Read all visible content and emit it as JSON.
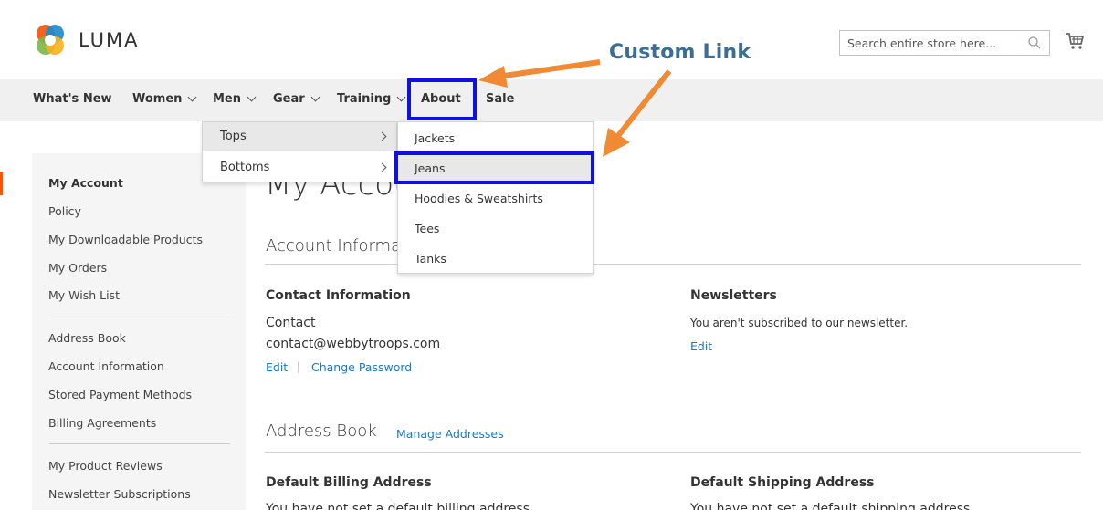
{
  "brand": {
    "name": "LUMA"
  },
  "search": {
    "placeholder": "Search entire store here..."
  },
  "annotation": {
    "custom_link": "Custom Link"
  },
  "nav": {
    "items": [
      {
        "label": "What's New",
        "has_chevron": false
      },
      {
        "label": "Women",
        "has_chevron": true
      },
      {
        "label": "Men",
        "has_chevron": true
      },
      {
        "label": "Gear",
        "has_chevron": true
      },
      {
        "label": "Training",
        "has_chevron": true
      },
      {
        "label": "About",
        "has_chevron": false
      },
      {
        "label": "Sale",
        "has_chevron": false
      }
    ]
  },
  "men_menu": {
    "items": [
      "Tops",
      "Bottoms"
    ]
  },
  "tops_menu": {
    "items": [
      "Jackets",
      "Jeans",
      "Hoodies & Sweatshirts",
      "Tees",
      "Tanks"
    ]
  },
  "sidebar": {
    "items": [
      "My Account",
      "Policy",
      "My Downloadable Products",
      "My Orders",
      "My Wish List",
      "Address Book",
      "Account Information",
      "Stored Payment Methods",
      "Billing Agreements",
      "My Product Reviews",
      "Newsletter Subscriptions"
    ]
  },
  "main": {
    "page_title": "My Account",
    "account_info": {
      "title": "Account Information",
      "contact": {
        "title": "Contact Information",
        "name": "Contact",
        "email": "contact@webbytroops.com",
        "edit_label": "Edit",
        "separator": "|",
        "change_password_label": "Change Password"
      },
      "newsletters": {
        "title": "Newsletters",
        "text": "You aren't subscribed to our newsletter.",
        "edit_label": "Edit"
      }
    },
    "address_book": {
      "title": "Address Book",
      "manage_label": "Manage Addresses",
      "billing": {
        "title": "Default Billing Address",
        "text": "You have not set a default billing address."
      },
      "shipping": {
        "title": "Default Shipping Address",
        "text": "You have not set a default shipping address."
      }
    }
  },
  "colors": {
    "accent": "#ff5501",
    "link": "#1979c3",
    "highlight_box": "#1010e0",
    "annotation_arrow": "#f08a34",
    "annotation_text": "#3a6f93"
  }
}
